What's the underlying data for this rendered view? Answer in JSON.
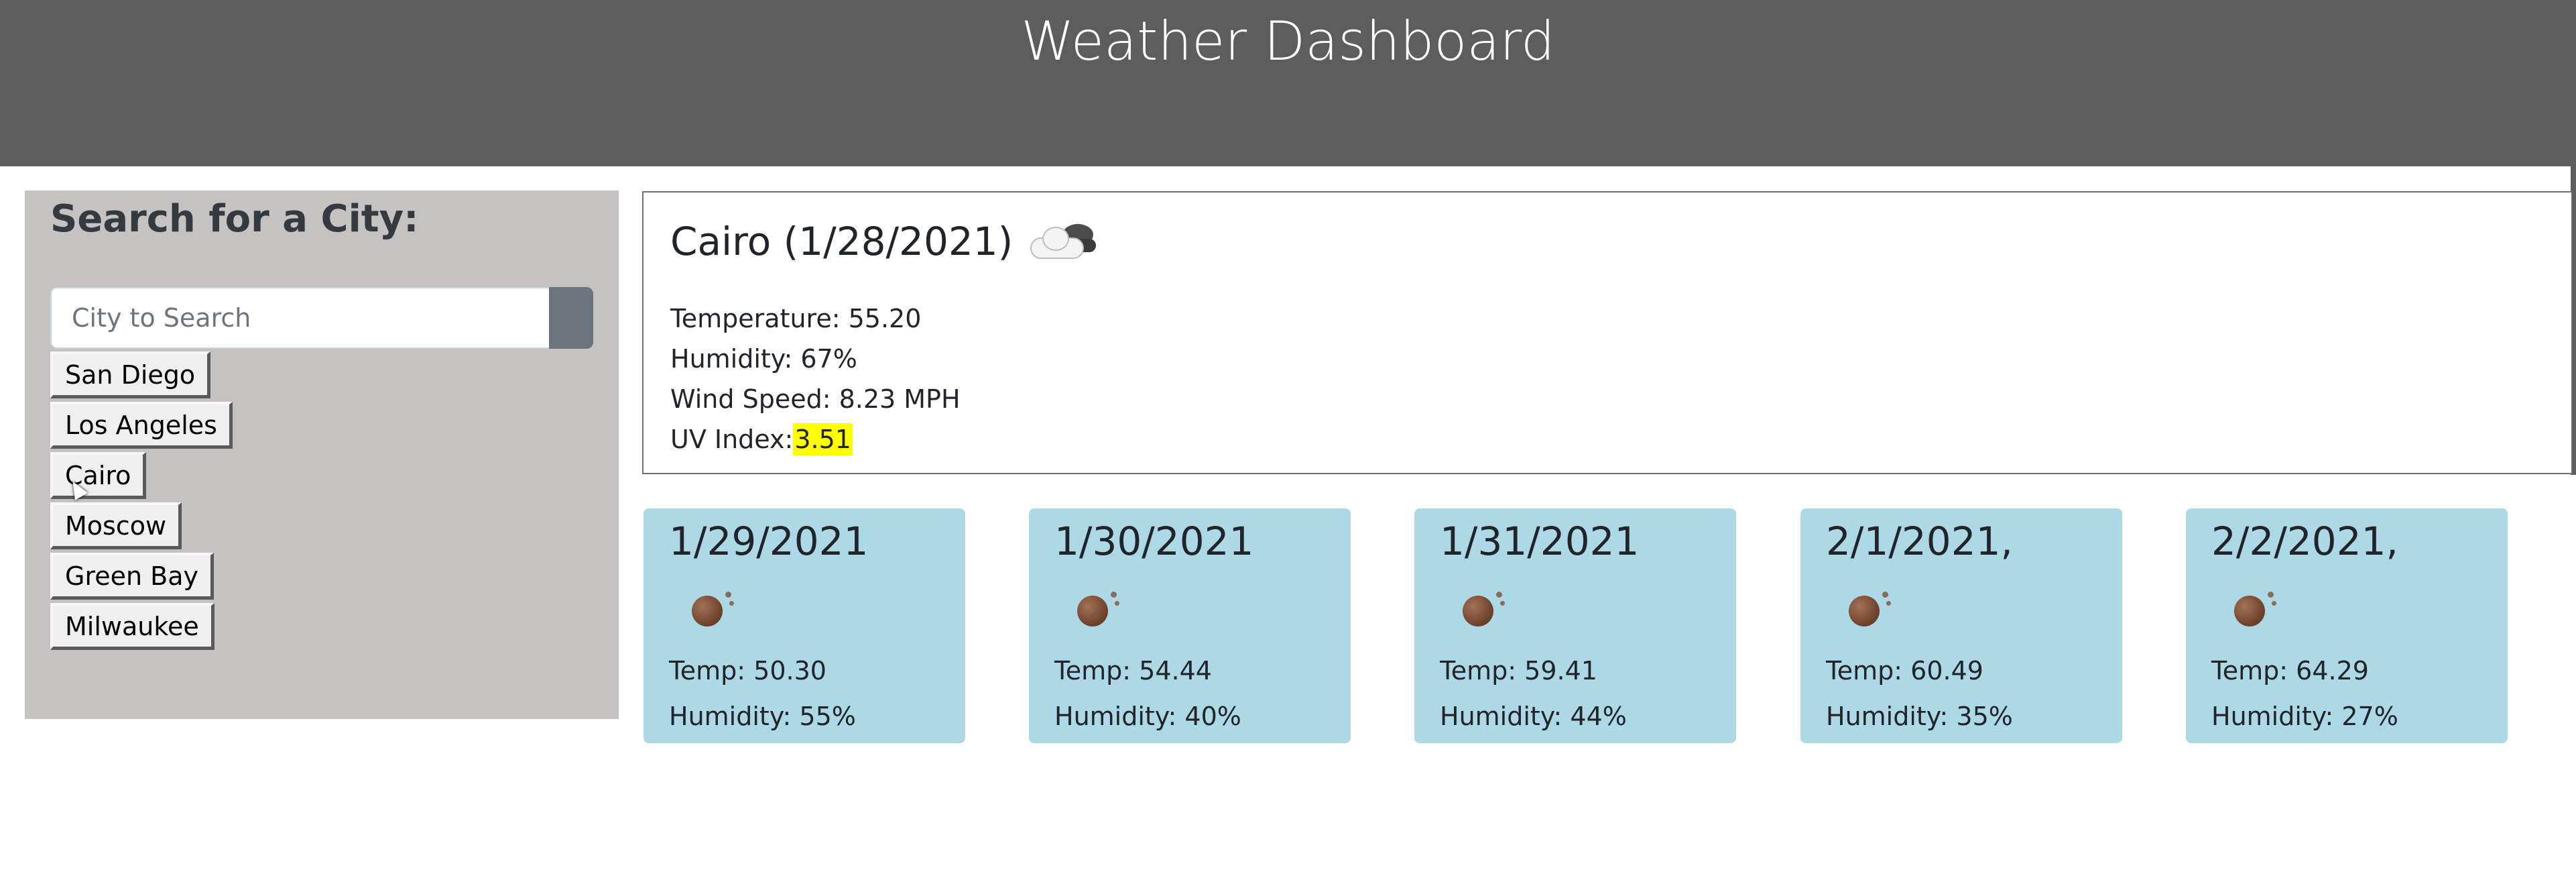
{
  "header": {
    "title": "Weather Dashboard"
  },
  "sidebar": {
    "title": "Search for a City:",
    "search": {
      "placeholder": "City to Search",
      "value": ""
    },
    "cities": [
      "San Diego",
      "Los Angeles",
      "Cairo",
      "Moscow",
      "Green Bay",
      "Milwaukee"
    ]
  },
  "current": {
    "title": "Cairo (1/28/2021)",
    "icon": "partly-cloudy-night-icon",
    "temperature": "Temperature: 55.20",
    "humidity": "Humidity: 67%",
    "wind": "Wind Speed: 8.23 MPH",
    "uv_label": "UV Index:",
    "uv_value": "3.51",
    "uv_color": "#ffff00"
  },
  "forecast": [
    {
      "date": "1/29/2021",
      "icon": "weather-icon",
      "temp": "Temp: 50.30",
      "humidity": "Humidity: 55%"
    },
    {
      "date": "1/30/2021",
      "icon": "weather-icon",
      "temp": "Temp: 54.44",
      "humidity": "Humidity: 40%"
    },
    {
      "date": "1/31/2021",
      "icon": "weather-icon",
      "temp": "Temp: 59.41",
      "humidity": "Humidity: 44%"
    },
    {
      "date": "2/1/2021,",
      "icon": "weather-icon",
      "temp": "Temp: 60.49",
      "humidity": "Humidity: 35%"
    },
    {
      "date": "2/2/2021,",
      "icon": "weather-icon",
      "temp": "Temp: 64.29",
      "humidity": "Humidity: 27%"
    }
  ],
  "colors": {
    "header_bg": "#5d5d5d",
    "sidebar_bg": "#c4c3c2",
    "forecast_bg": "#add8e6",
    "search_button": "#6c757d"
  }
}
